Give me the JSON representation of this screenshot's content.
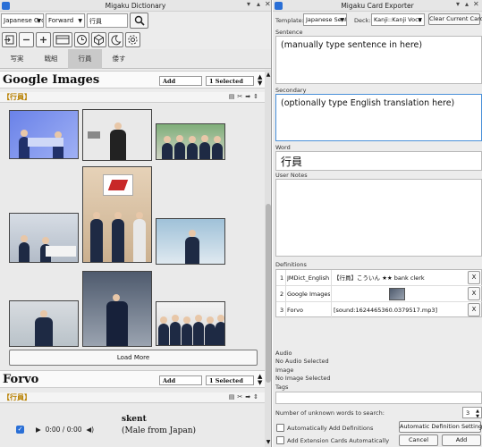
{
  "left_window": {
    "title": "Migaku Dictionary",
    "dict_group": "Japanese Gro",
    "direction": "Forward",
    "search_value": "行員",
    "tabs": [
      "写実",
      "戦組",
      "行員",
      "倭す"
    ],
    "active_tab_index": 2,
    "google": {
      "section_title": "Google Images",
      "add_label": "Add",
      "selected_label": "1 Selected",
      "term_label": "【行員】",
      "load_more_label": "Load More"
    },
    "forvo": {
      "section_title": "Forvo",
      "add_label": "Add",
      "selected_label": "1 Selected",
      "term_label": "【行員】",
      "time_label": "0:00 / 0:00",
      "speaker_name": "skent",
      "speaker_origin": "(Male from Japan)"
    }
  },
  "right_window": {
    "title": "Migaku Card Exporter",
    "template_label": "Template:",
    "template_value": "Japanese Senter",
    "deck_label": "Deck:",
    "deck_value": "Kanji::Kanji Voca",
    "clear_button": "Clear Current Card",
    "sentence_label": "Sentence",
    "sentence_value": "(manually type sentence in here)",
    "secondary_label": "Secondary",
    "secondary_value": "(optionally type English translation here)",
    "word_label": "Word",
    "word_value": "行員",
    "user_notes_label": "User Notes",
    "definitions_label": "Definitions",
    "definitions": [
      {
        "num": "1",
        "source": "JMDict_English",
        "content": "【行員】こういん ★★ bank clerk",
        "remove": "X"
      },
      {
        "num": "2",
        "source": "Google Images",
        "content": "",
        "remove": "X"
      },
      {
        "num": "3",
        "source": "Forvo",
        "content": "[sound:1624465360.0379517.mp3]",
        "remove": "X"
      }
    ],
    "audio_label": "Audio",
    "audio_value": "No Audio Selected",
    "image_label": "Image",
    "image_value": "No Image Selected",
    "tags_label": "Tags",
    "unknown_words_label": "Number of unknown words to search:",
    "unknown_words_value": "3",
    "auto_add_label": "Automatically Add Definitions",
    "auto_settings_button": "Automatic Definition Settings",
    "add_extension_label": "Add Extension Cards Automatically",
    "cancel_button": "Cancel",
    "add_button": "Add"
  }
}
